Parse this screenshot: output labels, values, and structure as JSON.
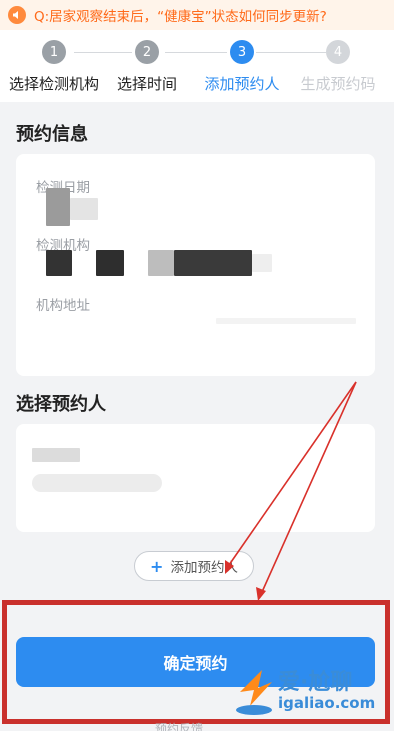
{
  "notice": {
    "icon": "speaker-icon",
    "text": "Q:居家观察结束后，“健康宝”状态如何同步更新?"
  },
  "steps": [
    {
      "num": "1",
      "label": "选择检测机构",
      "state": "done"
    },
    {
      "num": "2",
      "label": "选择时间",
      "state": "done"
    },
    {
      "num": "3",
      "label": "添加预约人",
      "state": "active"
    },
    {
      "num": "4",
      "label": "生成预约码",
      "state": "future"
    }
  ],
  "booking_info": {
    "title": "预约信息",
    "fields": [
      {
        "label": "检测日期",
        "value": ""
      },
      {
        "label": "检测机构",
        "value": ""
      },
      {
        "label": "机构地址",
        "value": ""
      }
    ]
  },
  "person_section": {
    "title": "选择预约人",
    "add_button": "添加预约人"
  },
  "confirm_button": "确定预约",
  "footer_text": "预约反馈",
  "watermark": {
    "line1": "爱·尬聊",
    "line2": "igaliao.com"
  },
  "colors": {
    "accent": "#2d8cf0",
    "notice_text": "#ff6a1a",
    "annotation_red": "#c9302c"
  }
}
